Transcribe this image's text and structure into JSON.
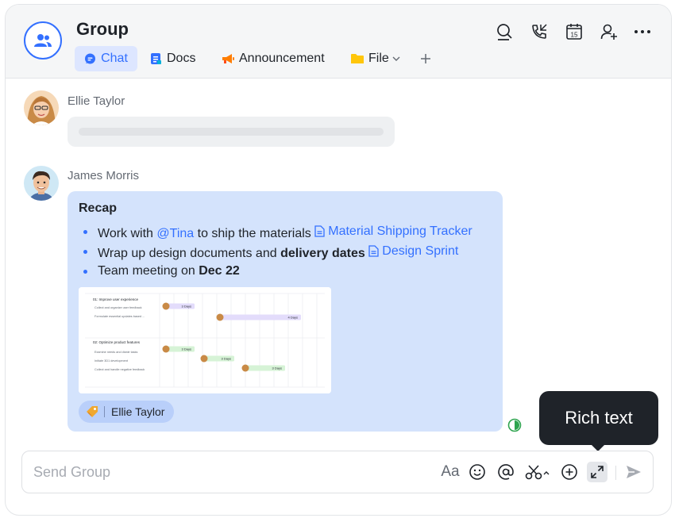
{
  "header": {
    "title": "Group",
    "tabs": [
      {
        "label": "Chat",
        "icon": "chat-bubble-icon",
        "active": true
      },
      {
        "label": "Docs",
        "icon": "docs-icon",
        "active": false
      },
      {
        "label": "Announcement",
        "icon": "megaphone-icon",
        "active": false
      },
      {
        "label": "File",
        "icon": "folder-icon",
        "active": false
      }
    ],
    "add_tab_icon": "plus-icon",
    "actions": [
      "search-icon",
      "phone-call-icon",
      "calendar-icon",
      "add-member-icon",
      "more-icon"
    ],
    "calendar_day": "15",
    "accent_color": "#3370ff"
  },
  "messages": [
    {
      "sender": "Ellie Taylor",
      "content": ""
    },
    {
      "sender": "James Morris",
      "recap_title": "Recap",
      "bullets": [
        {
          "text": "Work with ",
          "mention": "@Tina",
          "text2": " to ship the materials ",
          "doc": "Material Shipping Tracker"
        },
        {
          "text": "Wrap up design documents and ",
          "bold": "delivery dates",
          "doc": "Design Sprint"
        },
        {
          "text": "Team meeting on ",
          "bold": "Dec 22"
        }
      ],
      "gantt": {
        "sections": [
          {
            "title": "01: Improve user experience",
            "rows": [
              "Collect and organize user feedback",
              "Formulate essential updates based ..."
            ]
          },
          {
            "title": "02: Optimize product features",
            "rows": [
              "Examine needs and divide tasks",
              "Initiate 3D1 development",
              "Collect and handle negative feedback"
            ]
          }
        ],
        "bars": [
          {
            "label": "3 Days",
            "color": "#e3dcfb"
          },
          {
            "label": "4 Days",
            "color": "#e3dcfb"
          },
          {
            "label": "3 Days",
            "color": "#d6f3d6"
          },
          {
            "label": "3 Days",
            "color": "#d6f3d6"
          },
          {
            "label": "3 Days",
            "color": "#d6f3d6"
          }
        ]
      },
      "reaction": {
        "emoji": "🏷",
        "user": "Ellie Taylor"
      }
    }
  ],
  "tooltip": "Rich text",
  "composer": {
    "placeholder": "Send Group",
    "tools": [
      "font-format-icon",
      "emoji-icon",
      "mention-icon",
      "screenshot-scissors-icon",
      "add-icon",
      "expand-icon",
      "send-icon"
    ],
    "font_glyph": "Aa"
  }
}
